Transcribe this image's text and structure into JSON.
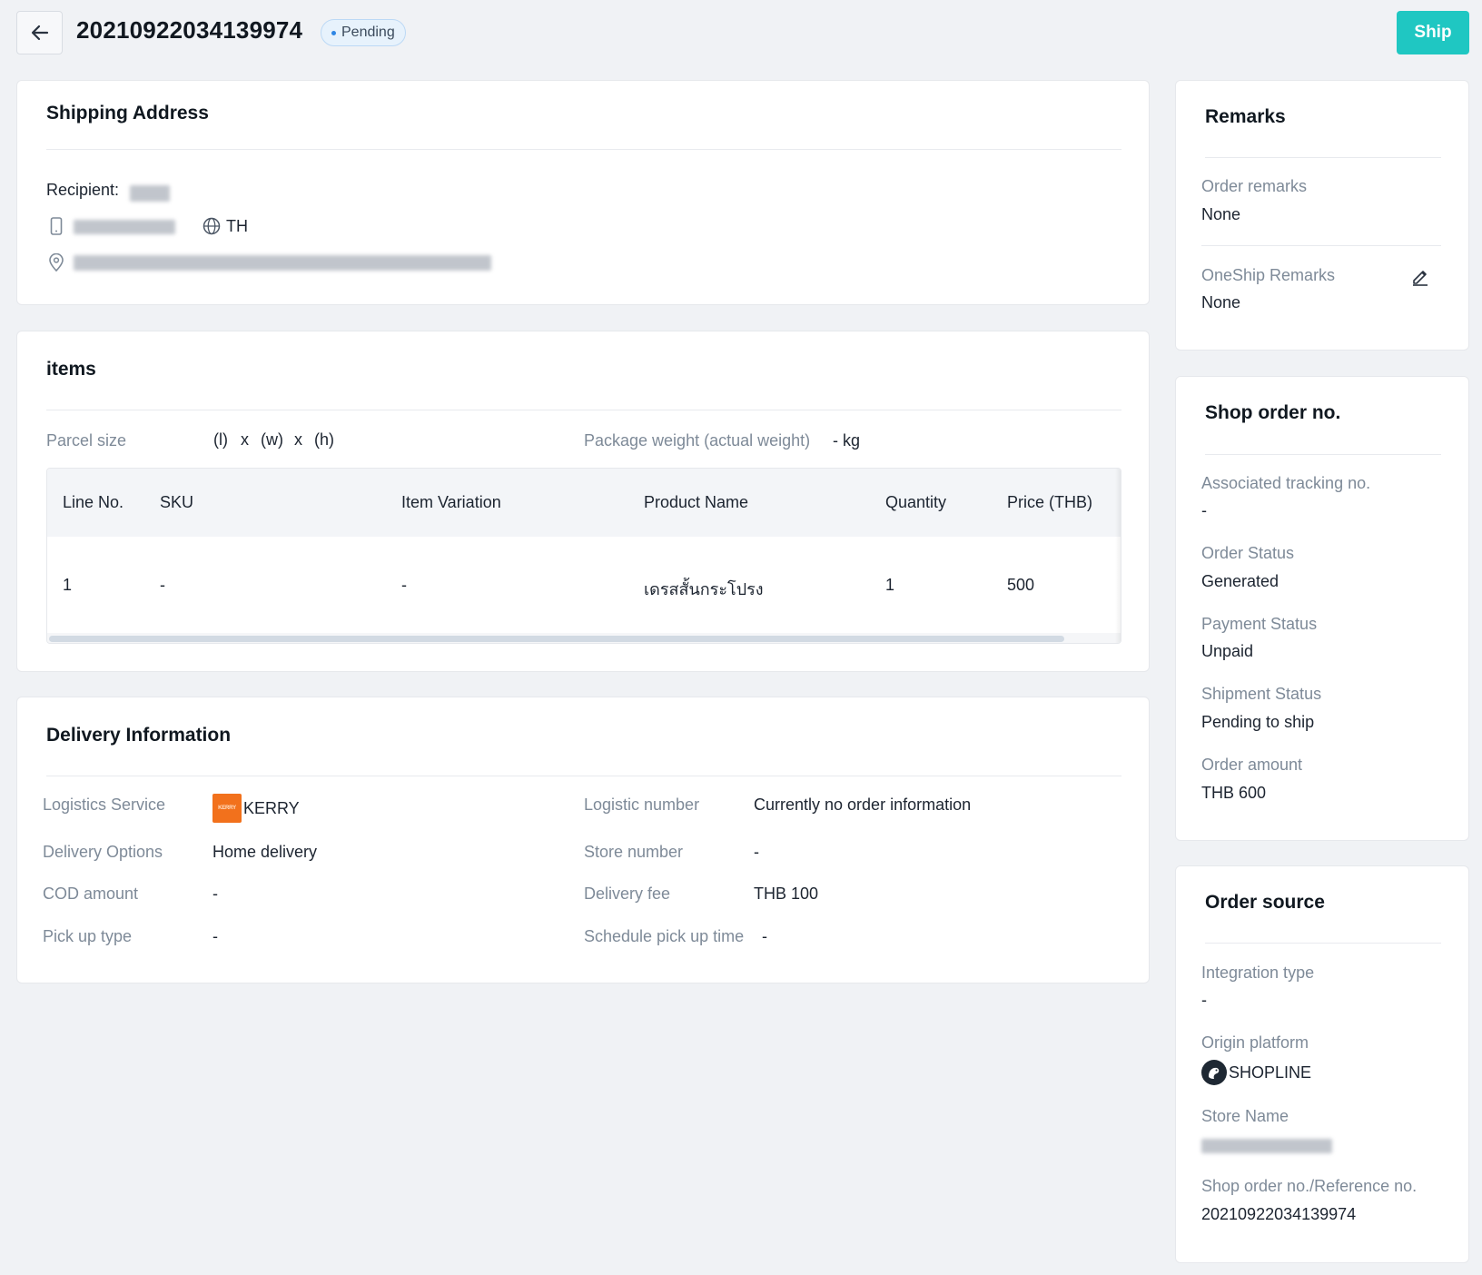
{
  "header": {
    "order_no": "20210922034139974",
    "status": "Pending",
    "ship_label": "Ship"
  },
  "shipping_address": {
    "title": "Shipping Address",
    "recipient_label": "Recipient:",
    "country": "TH"
  },
  "items": {
    "title": "items",
    "parcel_size_label": "Parcel size",
    "parcel_l": "(l)",
    "parcel_x1": "x",
    "parcel_w": "(w)",
    "parcel_x2": "x",
    "parcel_h": "(h)",
    "weight_label": "Package weight (actual weight)",
    "weight_value": "- kg",
    "columns": [
      "Line No.",
      "SKU",
      "Item Variation",
      "Product Name",
      "Quantity",
      "Price (THB)"
    ],
    "rows": [
      [
        "1",
        "-",
        "-",
        "เดรสสั้นกระโปรง",
        "1",
        "500"
      ]
    ]
  },
  "delivery": {
    "title": "Delivery Information",
    "logistics_service_label": "Logistics Service",
    "logistics_service_value": "KERRY",
    "kerry_logo_text": "KERRY",
    "logistic_number_label": "Logistic number",
    "logistic_number_value": "Currently no order information",
    "delivery_options_label": "Delivery Options",
    "delivery_options_value": "Home delivery",
    "store_number_label": "Store number",
    "store_number_value": "-",
    "cod_label": "COD amount",
    "cod_value": "-",
    "delivery_fee_label": "Delivery fee",
    "delivery_fee_value": "THB 100",
    "pickup_type_label": "Pick up type",
    "pickup_type_value": "-",
    "schedule_label": "Schedule pick up time",
    "schedule_value": "-"
  },
  "remarks": {
    "title": "Remarks",
    "order_remarks_label": "Order remarks",
    "order_remarks_value": "None",
    "oneship_remarks_label": "OneShip Remarks",
    "oneship_remarks_value": "None"
  },
  "shop_order": {
    "title": "Shop order no.",
    "tracking_label": "Associated tracking no.",
    "tracking_value": "-",
    "order_status_label": "Order Status",
    "order_status_value": "Generated",
    "payment_status_label": "Payment Status",
    "payment_status_value": "Unpaid",
    "shipment_status_label": "Shipment Status",
    "shipment_status_value": "Pending to ship",
    "order_amount_label": "Order amount",
    "order_amount_value": "THB 600"
  },
  "order_source": {
    "title": "Order source",
    "integration_label": "Integration type",
    "integration_value": "-",
    "origin_label": "Origin platform",
    "origin_value": "SHOPLINE",
    "store_name_label": "Store Name",
    "reference_label": "Shop order no./Reference no.",
    "reference_value": "20210922034139974"
  },
  "icons": {
    "back": "arrow-left-icon",
    "phone": "phone-icon",
    "globe": "globe-icon",
    "location": "location-pin-icon",
    "edit": "pencil-icon"
  },
  "colors": {
    "accent": "#1fc7c2",
    "status_dot": "#2f86e4",
    "kerry": "#f2711c"
  }
}
